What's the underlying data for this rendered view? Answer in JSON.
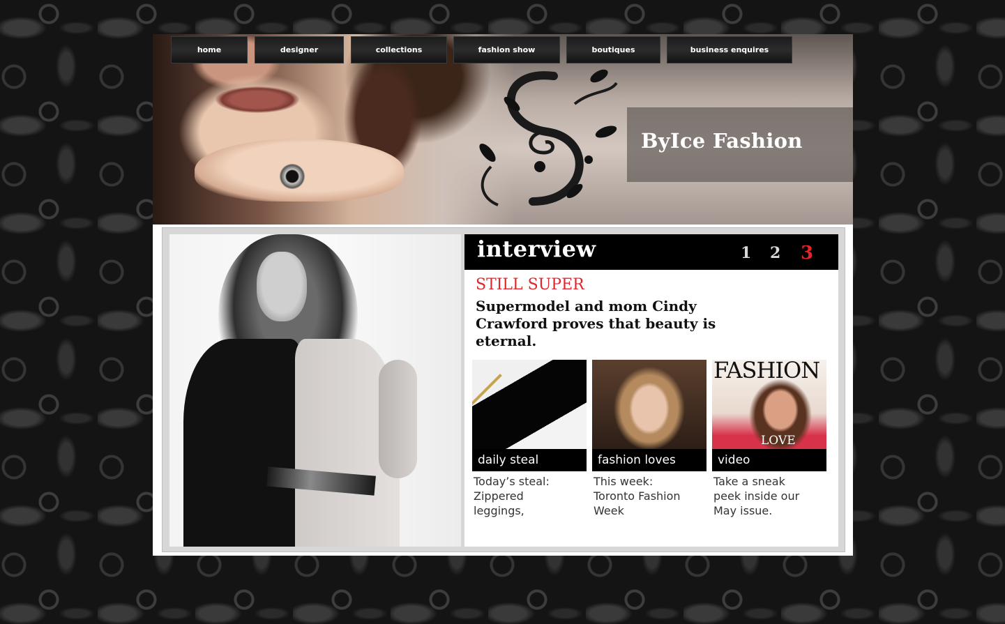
{
  "site": {
    "title": "ByIce Fashion"
  },
  "nav": {
    "items": [
      {
        "label": "home"
      },
      {
        "label": "designer"
      },
      {
        "label": "collections"
      },
      {
        "label": "fashion show"
      },
      {
        "label": "boutiques"
      },
      {
        "label": "business enquires"
      }
    ]
  },
  "interview": {
    "title": "interview",
    "pages": [
      "1",
      "2",
      "3"
    ],
    "active_page": "3",
    "kicker": "STILL SUPER",
    "headline_lines": [
      "Supermodel and mom Cindy",
      "Crawford proves that beauty is",
      "eternal."
    ]
  },
  "cards": [
    {
      "label": "daily steal",
      "text_lines": [
        "Today’s steal:",
        "Zippered",
        "leggings,"
      ]
    },
    {
      "label": "fashion loves",
      "text_lines": [
        "This week:",
        "Toronto Fashion",
        "Week"
      ]
    },
    {
      "label": "video",
      "text_lines": [
        "Take a sneak",
        "peek inside our",
        "May issue."
      ],
      "magazine_masthead": "FASHION",
      "magazine_cover_word": "LOVE"
    }
  ],
  "colors": {
    "accent_red": "#e0262b",
    "nav_bg": "#1b1b1b",
    "page_bg": "#141414"
  }
}
